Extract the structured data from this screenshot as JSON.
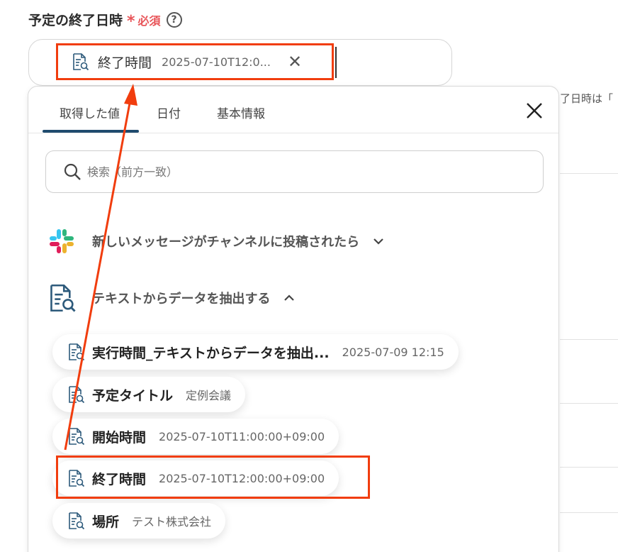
{
  "field": {
    "label": "予定の終了日時",
    "required_star": "*",
    "required_text": "必須",
    "help": "?"
  },
  "selected_chip": {
    "label": "終了時間",
    "value": "2025-07-10T12:0..."
  },
  "background_hint": "了日時は「",
  "tabs": [
    {
      "label": "取得した値"
    },
    {
      "label": "日付"
    },
    {
      "label": "基本情報"
    }
  ],
  "search": {
    "placeholder": "検索（前方一致）"
  },
  "sections": [
    {
      "label": "新しいメッセージがチャンネルに投稿されたら",
      "icon": "slack-icon",
      "expanded": false
    },
    {
      "label": "テキストからデータを抽出する",
      "icon": "document-search-icon",
      "expanded": true
    }
  ],
  "items": [
    {
      "label": "実行時間_テキストからデータを抽出...",
      "value": "2025-07-09 12:15"
    },
    {
      "label": "予定タイトル",
      "value": "定例会議"
    },
    {
      "label": "開始時間",
      "value": "2025-07-10T11:00:00+09:00"
    },
    {
      "label": "終了時間",
      "value": "2025-07-10T12:00:00+09:00"
    },
    {
      "label": "場所",
      "value": "テスト株式会社"
    }
  ],
  "colors": {
    "highlight": "#f13d0e",
    "accent": "#1f4b6e",
    "required": "#e8565a",
    "icon": "#2d5a7b"
  }
}
